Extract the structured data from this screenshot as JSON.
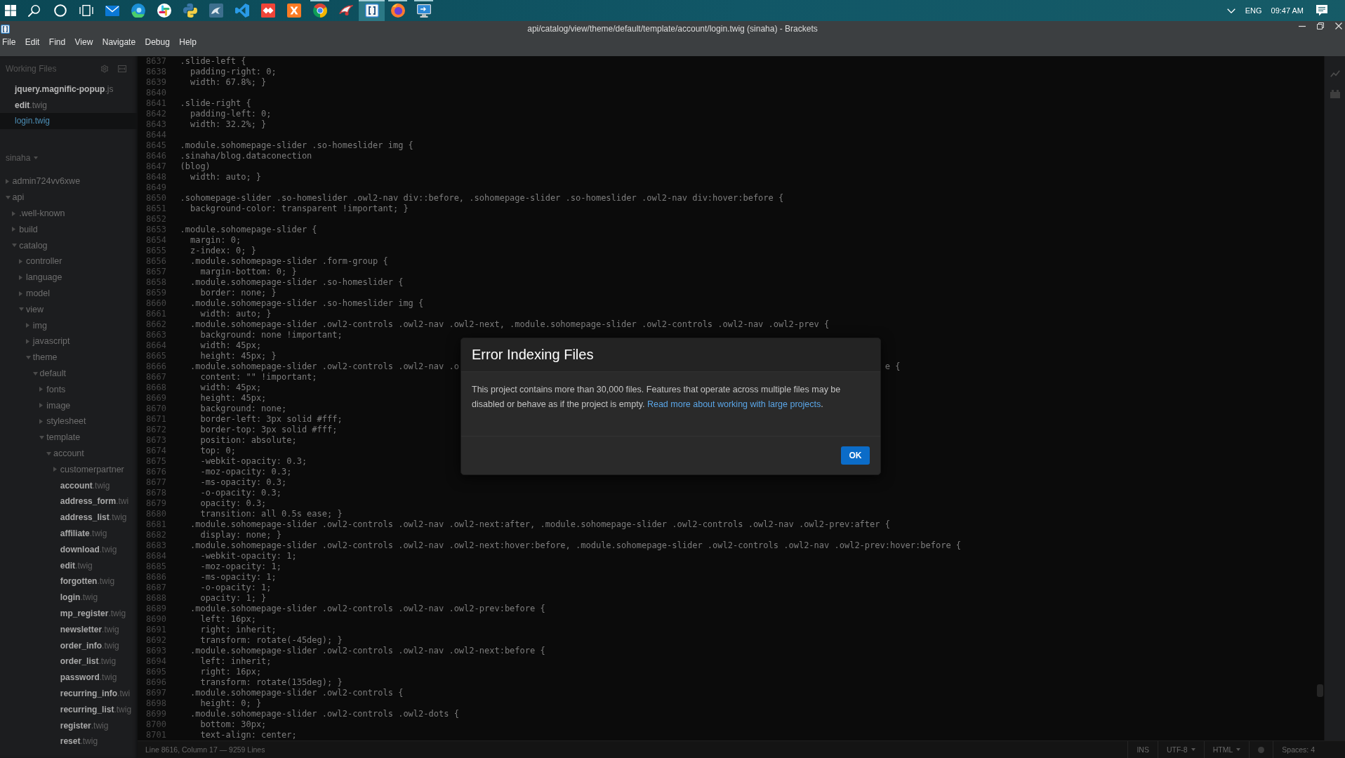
{
  "taskbar": {
    "apps": [
      {
        "kind": "grid",
        "running": false,
        "selected": false
      },
      {
        "kind": "search",
        "running": false,
        "selected": false
      },
      {
        "kind": "ring",
        "running": false,
        "selected": false
      },
      {
        "kind": "taskview",
        "running": false,
        "selected": false
      },
      {
        "kind": "envelope",
        "running": false,
        "selected": false
      },
      {
        "kind": "swirl",
        "running": false,
        "selected": false
      },
      {
        "kind": "pinwheel",
        "running": false,
        "selected": false
      },
      {
        "kind": "snake",
        "running": false,
        "selected": false
      },
      {
        "kind": "dolphin",
        "running": false,
        "selected": false
      },
      {
        "kind": "ribbon",
        "running": false,
        "selected": false
      },
      {
        "kind": "diamond",
        "running": false,
        "selected": false
      },
      {
        "kind": "cross",
        "running": false,
        "selected": false
      },
      {
        "kind": "tricolor",
        "running": true,
        "selected": false
      },
      {
        "kind": "wing",
        "running": false,
        "selected": false
      },
      {
        "kind": "brackets",
        "running": true,
        "selected": true
      },
      {
        "kind": "flame",
        "running": true,
        "selected": false
      },
      {
        "kind": "monitor",
        "running": true,
        "selected": false
      }
    ],
    "tray": {
      "language": "ENG",
      "time": "09:47 AM"
    }
  },
  "window": {
    "title": "api/catalog/view/theme/default/template/account/login.twig (sinaha) - Brackets"
  },
  "menu": {
    "items": [
      "File",
      "Edit",
      "Find",
      "View",
      "Navigate",
      "Debug",
      "Help"
    ]
  },
  "sidebar": {
    "working_files_title": "Working Files",
    "working_files": [
      {
        "name": "**jquery.magnific-popup**.js",
        "selected": false
      },
      {
        "name": "**edit**.twig",
        "selected": false
      },
      {
        "name": "**login**.twig",
        "selected": true
      }
    ],
    "project": "sinaha",
    "tree": [
      {
        "kind": "folder",
        "name": "admin724vv6xwe",
        "expanded": false
      },
      {
        "kind": "folder",
        "name": "api",
        "expanded": true,
        "children": [
          {
            "kind": "folder",
            "name": ".well-known",
            "expanded": false
          },
          {
            "kind": "folder",
            "name": "build",
            "expanded": false
          },
          {
            "kind": "folder",
            "name": "catalog",
            "expanded": true,
            "children": [
              {
                "kind": "folder",
                "name": "controller",
                "expanded": false
              },
              {
                "kind": "folder",
                "name": "language",
                "expanded": false
              },
              {
                "kind": "folder",
                "name": "model",
                "expanded": false
              },
              {
                "kind": "folder",
                "name": "view",
                "expanded": true,
                "children": [
                  {
                    "kind": "folder",
                    "name": "img",
                    "expanded": false
                  },
                  {
                    "kind": "folder",
                    "name": "javascript",
                    "expanded": false
                  },
                  {
                    "kind": "folder",
                    "name": "theme",
                    "expanded": true,
                    "children": [
                      {
                        "kind": "folder",
                        "name": "default",
                        "expanded": true,
                        "children": [
                          {
                            "kind": "folder",
                            "name": "fonts",
                            "expanded": false
                          },
                          {
                            "kind": "folder",
                            "name": "image",
                            "expanded": false
                          },
                          {
                            "kind": "folder",
                            "name": "stylesheet",
                            "expanded": false
                          },
                          {
                            "kind": "folder",
                            "name": "template",
                            "expanded": true,
                            "children": [
                              {
                                "kind": "folder",
                                "name": "account",
                                "expanded": true,
                                "children": [
                                  {
                                    "kind": "folder",
                                    "name": "customerpartner",
                                    "expanded": false
                                  },
                                  {
                                    "kind": "file",
                                    "name": "**account**.twig"
                                  },
                                  {
                                    "kind": "file",
                                    "name": "**address_form**.twi"
                                  },
                                  {
                                    "kind": "file",
                                    "name": "**address_list**.twig"
                                  },
                                  {
                                    "kind": "file",
                                    "name": "**affiliate**.twig"
                                  },
                                  {
                                    "kind": "file",
                                    "name": "**download**.twig"
                                  },
                                  {
                                    "kind": "file",
                                    "name": "**edit**.twig"
                                  },
                                  {
                                    "kind": "file",
                                    "name": "**forgotten**.twig"
                                  },
                                  {
                                    "kind": "file",
                                    "name": "**login**.twig"
                                  },
                                  {
                                    "kind": "file",
                                    "name": "**mp_register**.twig"
                                  },
                                  {
                                    "kind": "file",
                                    "name": "**newsletter**.twig"
                                  },
                                  {
                                    "kind": "file",
                                    "name": "**order_info**.twig"
                                  },
                                  {
                                    "kind": "file",
                                    "name": "**order_list**.twig"
                                  },
                                  {
                                    "kind": "file",
                                    "name": "**password**.twig"
                                  },
                                  {
                                    "kind": "file",
                                    "name": "**recurring_info**.twi"
                                  },
                                  {
                                    "kind": "file",
                                    "name": "**recurring_list**.twig"
                                  },
                                  {
                                    "kind": "file",
                                    "name": "**register**.twig"
                                  },
                                  {
                                    "kind": "file",
                                    "name": "**reset**.twig"
                                  }
                                ]
                              }
                            ]
                          }
                        ]
                      }
                    ]
                  }
                ]
              }
            ]
          }
        ]
      }
    ]
  },
  "editor": {
    "lines": [
      {
        "number": "8637",
        "code": ".slide-left {"
      },
      {
        "number": "8638",
        "code": "  padding-right: 0;"
      },
      {
        "number": "8639",
        "code": "  width: 67.8%; }"
      },
      {
        "number": "8640"
      },
      {
        "number": "8641",
        "code": ".slide-right {"
      },
      {
        "number": "8642",
        "code": "  padding-left: 0;"
      },
      {
        "number": "8643",
        "code": "  width: 32.2%; }"
      },
      {
        "number": "8644"
      },
      {
        "number": "8645",
        "code": ".module.sohomepage-slider .so-homeslider img {"
      },
      {
        "number": "8646",
        "code": ".sinaha/blog.dataconection"
      },
      {
        "number": "8647",
        "code": "(blog)"
      },
      {
        "number": "8648",
        "code": "  width: auto; }"
      },
      {
        "number": "8649"
      },
      {
        "number": "8650",
        "code": ".sohomepage-slider .so-homeslider .owl2-nav div::before, .sohomepage-slider .so-homeslider .owl2-nav div:hover:before {"
      },
      {
        "number": "8651",
        "code": "  background-color: transparent !important; }"
      },
      {
        "number": "8652"
      },
      {
        "number": "8653",
        "code": ".module.sohomepage-slider {"
      },
      {
        "number": "8654",
        "code": "  margin: 0;"
      },
      {
        "number": "8655",
        "code": "  z-index: 0; }"
      },
      {
        "number": "8656",
        "code": "  .module.sohomepage-slider .form-group {"
      },
      {
        "number": "8657",
        "code": "    margin-bottom: 0; }"
      },
      {
        "number": "8658",
        "code": "  .module.sohomepage-slider .so-homeslider {"
      },
      {
        "number": "8659",
        "code": "    border: none; }"
      },
      {
        "number": "8660",
        "code": "  .module.sohomepage-slider .so-homeslider img {"
      },
      {
        "number": "8661",
        "code": "    width: auto; }"
      },
      {
        "number": "8662",
        "code": "  .module.sohomepage-slider .owl2-controls .owl2-nav .owl2-next, .module.sohomepage-slider .owl2-controls .owl2-nav .owl2-prev {"
      },
      {
        "number": "8663",
        "code": "    background: none !important;"
      },
      {
        "number": "8664",
        "code": "    width: 45px;"
      },
      {
        "number": "8665",
        "code": "    height: 45px; }"
      },
      {
        "number": "8666",
        "code": "  .module.sohomepage-slider .owl2-controls .owl2-nav .o",
        "code_right": "e {"
      },
      {
        "number": "8667",
        "code": "    content: \"\" !important;"
      },
      {
        "number": "8668",
        "code": "    width: 45px;"
      },
      {
        "number": "8669",
        "code": "    height: 45px;"
      },
      {
        "number": "8670",
        "code": "    background: none;"
      },
      {
        "number": "8671",
        "code": "    border-left: 3px solid #fff;"
      },
      {
        "number": "8672",
        "code": "    border-top: 3px solid #fff;"
      },
      {
        "number": "8673",
        "code": "    position: absolute;"
      },
      {
        "number": "8674",
        "code": "    top: 0;"
      },
      {
        "number": "8675",
        "code": "    -webkit-opacity: 0.3;"
      },
      {
        "number": "8676",
        "code": "    -moz-opacity: 0.3;"
      },
      {
        "number": "8677",
        "code": "    -ms-opacity: 0.3;"
      },
      {
        "number": "8678",
        "code": "    -o-opacity: 0.3;"
      },
      {
        "number": "8679",
        "code": "    opacity: 0.3;"
      },
      {
        "number": "8680",
        "code": "    transition: all 0.5s ease; }"
      },
      {
        "number": "8681",
        "code": "  .module.sohomepage-slider .owl2-controls .owl2-nav .owl2-next:after, .module.sohomepage-slider .owl2-controls .owl2-nav .owl2-prev:after {"
      },
      {
        "number": "8682",
        "code": "    display: none; }"
      },
      {
        "number": "8683",
        "code": "  .module.sohomepage-slider .owl2-controls .owl2-nav .owl2-next:hover:before, .module.sohomepage-slider .owl2-controls .owl2-nav .owl2-prev:hover:before {"
      },
      {
        "number": "8684",
        "code": "    -webkit-opacity: 1;"
      },
      {
        "number": "8685",
        "code": "    -moz-opacity: 1;"
      },
      {
        "number": "8686",
        "code": "    -ms-opacity: 1;"
      },
      {
        "number": "8687",
        "code": "    -o-opacity: 1;"
      },
      {
        "number": "8688",
        "code": "    opacity: 1; }"
      },
      {
        "number": "8689",
        "code": "  .module.sohomepage-slider .owl2-controls .owl2-nav .owl2-prev:before {"
      },
      {
        "number": "8690",
        "code": "    left: 16px;"
      },
      {
        "number": "8691",
        "code": "    right: inherit;"
      },
      {
        "number": "8692",
        "code": "    transform: rotate(-45deg); }"
      },
      {
        "number": "8693",
        "code": "  .module.sohomepage-slider .owl2-controls .owl2-nav .owl2-next:before {"
      },
      {
        "number": "8694",
        "code": "    left: inherit;"
      },
      {
        "number": "8695",
        "code": "    right: 16px;"
      },
      {
        "number": "8696",
        "code": "    transform: rotate(135deg); }"
      },
      {
        "number": "8697",
        "code": "  .module.sohomepage-slider .owl2-controls {"
      },
      {
        "number": "8698",
        "code": "    height: 0; }"
      },
      {
        "number": "8699",
        "code": "  .module.sohomepage-slider .owl2-controls .owl2-dots {"
      },
      {
        "number": "8700",
        "code": "    bottom: 30px;"
      },
      {
        "number": "8701",
        "code": "    text-align: center;"
      }
    ]
  },
  "status_bar": {
    "cursor": "Line 8616, Column 17 — 9259 Lines",
    "mode": "INS",
    "encoding": "UTF-8",
    "language": "HTML",
    "indentation": "Spaces: 4"
  },
  "dialog": {
    "title": "Error Indexing Files",
    "message": "This project contains more than 30,000 files. Features that operate across multiple files may be disabled or behave as if the project is empty.",
    "link": "Read more about working with large projects",
    "message_end": ".",
    "button": "OK"
  }
}
